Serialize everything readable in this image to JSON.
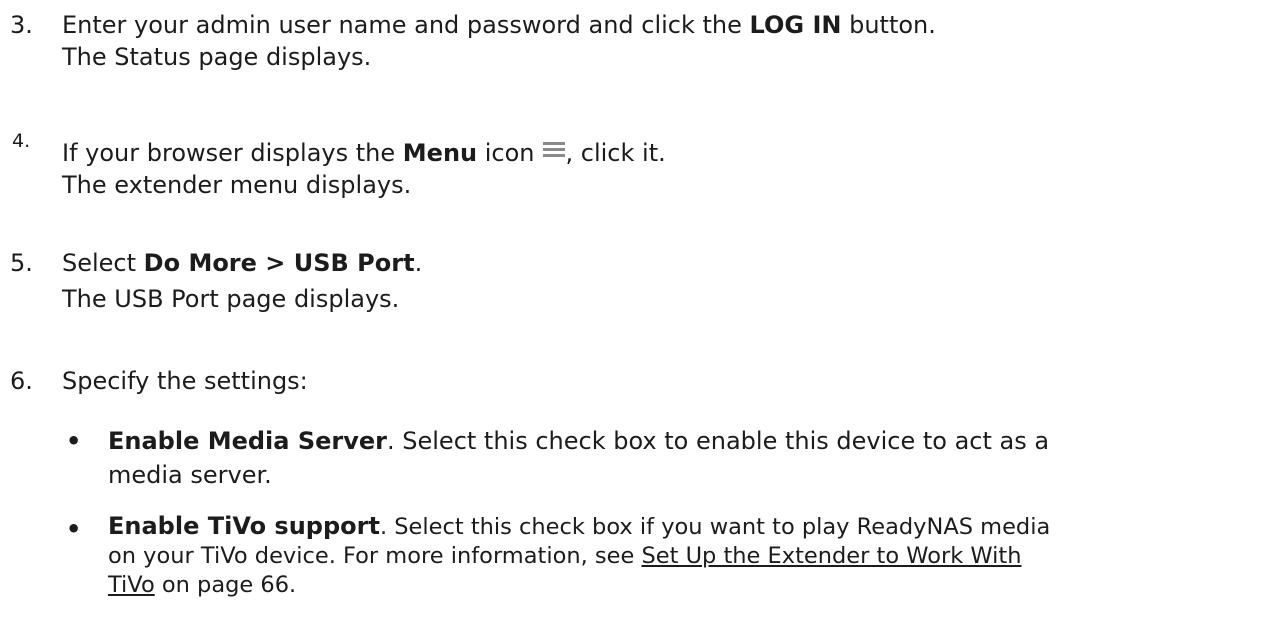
{
  "steps": [
    {
      "number": "3.",
      "before": "Enter your admin user name and password and click the ",
      "bold": "LOG IN",
      "after": " button.",
      "result": "The Status page displays."
    },
    {
      "number": "4.",
      "before": "If your browser displays the ",
      "bold": "Menu",
      "after_icon_prefix": " icon",
      "after": ", click it.",
      "icon": "menu-icon",
      "result": "The extender menu displays."
    },
    {
      "number": "5.",
      "before": "Select ",
      "bold": "Do More > USB Port",
      "after": ".",
      "result": "The USB Port page displays."
    },
    {
      "number": "6.",
      "text": "Specify the settings:"
    }
  ],
  "bullets": [
    {
      "bold": "Enable Media Server",
      "line1": ". Select this check box to enable this device to act as a",
      "line2": "media server."
    },
    {
      "bold": "Enable TiVo support",
      "line1": ". Select this check box if you want to play ReadyNAS media",
      "line2_before": "on your TiVo device. For more information, see ",
      "line2_link": "Set Up the Extender to Work With",
      "line3_link": "TiVo",
      "line3_after": " on page 66."
    }
  ]
}
